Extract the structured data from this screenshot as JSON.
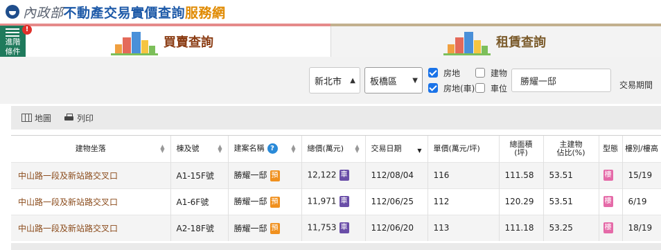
{
  "header": {
    "ministry": "內政部",
    "title_main": "不動產交易實價查詢",
    "title_suffix": "服務網"
  },
  "tabs": {
    "buy_label": "買賣查詢",
    "rent_label": "租賃查詢"
  },
  "advanced": {
    "label_line1": "進階",
    "label_line2": "條件",
    "alert": "!"
  },
  "filters": {
    "city": "新北市",
    "district": "板橋區",
    "checkboxes": [
      {
        "label": "房地",
        "checked": true
      },
      {
        "label": "建物",
        "checked": false
      },
      {
        "label": "房地(車)",
        "checked": true
      },
      {
        "label": "車位",
        "checked": false
      }
    ],
    "keyword": "勝耀一邸",
    "period_label": "交易期間"
  },
  "toolbar": {
    "map_label": "地圖",
    "print_label": "列印"
  },
  "table": {
    "headers": {
      "address": "建物坐落",
      "unit": "棟及號",
      "project": "建案名稱",
      "total_price": "總價(萬元)",
      "date": "交易日期",
      "unit_price": "單價(萬元/坪)",
      "area_line1": "總面積",
      "area_line2": "(坪)",
      "ratio_line1": "主建物",
      "ratio_line2": "佔比(%)",
      "type": "型態",
      "floor": "樓別/樓高"
    },
    "help_icon": "?",
    "rows": [
      {
        "address": "中山路一段及新站路交叉口",
        "unit": "A1-15F號",
        "project": "勝耀一邸",
        "project_tag": "預",
        "total_price": "12,122",
        "price_tag": "車",
        "date": "112/08/04",
        "unit_price": "116",
        "area": "111.58",
        "ratio": "53.51",
        "type_tag": "樓",
        "floor": "15/19"
      },
      {
        "address": "中山路一段及新站路交叉口",
        "unit": "A1-6F號",
        "project": "勝耀一邸",
        "project_tag": "預",
        "total_price": "11,971",
        "price_tag": "車",
        "date": "112/06/25",
        "unit_price": "112",
        "area": "120.29",
        "ratio": "53.51",
        "type_tag": "樓",
        "floor": "6/19"
      },
      {
        "address": "中山路一段及新站路交叉口",
        "unit": "A2-18F號",
        "project": "勝耀一邸",
        "project_tag": "預",
        "total_price": "11,753",
        "price_tag": "車",
        "date": "112/06/20",
        "unit_price": "113",
        "area": "111.18",
        "ratio": "53.25",
        "type_tag": "樓",
        "floor": "18/19"
      }
    ]
  },
  "colors": {
    "brand_blue": "#1e5aa8",
    "brand_orange": "#e08a00",
    "accent_green": "#1f7a5c",
    "address_brown": "#8a4a1a"
  }
}
